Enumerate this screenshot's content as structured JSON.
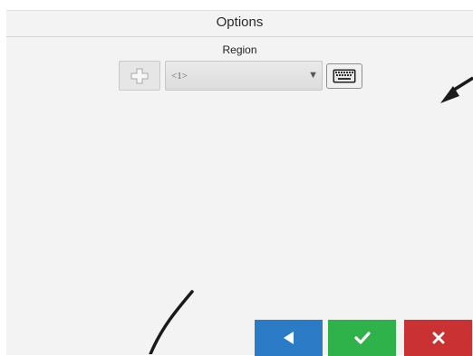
{
  "header": {
    "title": "Options"
  },
  "region": {
    "label": "Region",
    "selected_value": "<1>"
  },
  "icons": {
    "add": "plus-icon",
    "dropdown": "dropdown-arrow-icon",
    "keyboard": "keyboard-icon",
    "back": "back-arrow-icon",
    "confirm": "check-icon",
    "cancel": "close-icon"
  },
  "colors": {
    "back_button": "#2c7bc6",
    "confirm_button": "#2fb24a",
    "cancel_button": "#c93133"
  }
}
